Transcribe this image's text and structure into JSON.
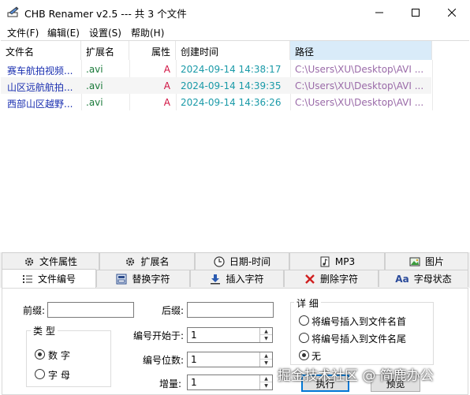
{
  "window": {
    "title": "CHB Renamer v2.5 --- 共 3 个文件",
    "minimize_glyph": "—",
    "maximize_glyph": "☐",
    "close_glyph": "✕"
  },
  "menu": {
    "file": "文件(F)",
    "edit": "编辑(E)",
    "settings": "设置(S)",
    "help": "帮助(H)"
  },
  "list": {
    "columns": [
      "文件名",
      "扩展名",
      "属性",
      "创建时间",
      "路径"
    ],
    "rows": [
      {
        "name": "赛车航拍视频...",
        "ext": ".avi",
        "attr": "A",
        "created": "2024-09-14 14:38:17",
        "path": "C:\\Users\\XU\\Desktop\\AVI ..."
      },
      {
        "name": "山区远航航拍...",
        "ext": ".avi",
        "attr": "A",
        "created": "2024-09-14 14:39:35",
        "path": "C:\\Users\\XU\\Desktop\\AVI ..."
      },
      {
        "name": "西部山区越野...",
        "ext": ".avi",
        "attr": "A",
        "created": "2024-09-14 14:36:26",
        "path": "C:\\Users\\XU\\Desktop\\AVI ..."
      }
    ],
    "colors": {
      "name": "#1a2fb0",
      "ext": "#1a7a3a",
      "attr": "#d01040",
      "created": "#1a9aa8",
      "path": "#9a6aa8"
    }
  },
  "tabs": {
    "row1": [
      "文件属性",
      "扩展名",
      "日期-时间",
      "MP3",
      "图片"
    ],
    "row2": [
      "文件编号",
      "替换字符",
      "插入字符",
      "删除字符",
      "字母状态"
    ],
    "active": "文件编号",
    "aa_glyph": "Aa"
  },
  "panel": {
    "prefix_label": "前缀:",
    "prefix_value": "",
    "suffix_label": "后缀:",
    "suffix_value": "",
    "type_group": "类 型",
    "type_digit": "数 字",
    "type_letter": "字 母",
    "start_label": "编号开始于:",
    "start_value": "1",
    "digits_label": "编号位数:",
    "digits_value": "1",
    "increment_label": "增量:",
    "increment_value": "1",
    "detail_group": "详 细",
    "opt_prefix": "将编号插入到文件名首",
    "opt_suffix": "将编号插入到文件名尾",
    "opt_none": "无",
    "execute": "执行",
    "preview": "预览"
  },
  "watermark": "掘金技术社区 @ 简鹿办公"
}
